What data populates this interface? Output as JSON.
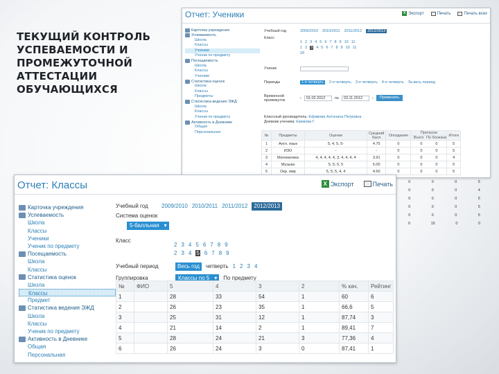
{
  "slide": {
    "title_lines": [
      "ТЕКУЩИЙ КОНТРОЛЬ",
      "УСПЕВАЕМОСТИ И",
      "ПРОМЕЖУТОЧНОЙ",
      "АТТЕСТАЦИИ",
      "ОБУЧАЮЩИХСЯ"
    ]
  },
  "shot1": {
    "title": "Отчет: Ученики",
    "toolbar": {
      "export": "Экспорт",
      "print": "Печать",
      "print_all": "Печать всех"
    },
    "sidebar": {
      "card": "Карточка учреждения",
      "progress": "Успеваемость",
      "progress_items": [
        "Школа",
        "Классы",
        "Ученики",
        "Ученик по предмету"
      ],
      "attendance": "Посещаемость",
      "attendance_items": [
        "Школа",
        "Классы",
        "Ученики"
      ],
      "grades_stats": "Статистика оценок",
      "grades_items": [
        "Школа",
        "Классы",
        "Предметы"
      ],
      "ejournal_stats": "Статистика ведения ЭЖД",
      "ejournal_items": [
        "Школа",
        "Классы",
        "Ученик по предмету"
      ],
      "activity": "Активность в Дневнике",
      "activity_items": [
        "Общая",
        "Персональная"
      ]
    },
    "form": {
      "year_label": "Учебный год",
      "years": [
        "2009/2010",
        "2010/2011",
        "2011/2012",
        "2012/2013"
      ],
      "class_label": "Класс",
      "class_row1": [
        "1",
        "2",
        "3",
        "4",
        "5",
        "6",
        "7",
        "8",
        "9",
        "10",
        "11"
      ],
      "class_row2": [
        "1",
        "2",
        "3",
        "4",
        "5",
        "6",
        "7",
        "8",
        "9",
        "10",
        "11"
      ],
      "class_extra": "2б",
      "student_label": "Ученик",
      "period_label": "Периоды",
      "periods": [
        "1-я четверть",
        "2-я четверть",
        "3-я четверть",
        "4-я четверть",
        "За весь период"
      ],
      "interval_label": "Временной промежуток",
      "date_from": "01.02.2012",
      "to_label": "по",
      "date_to": "03.11.2012",
      "apply": "Применить"
    },
    "info": {
      "teacher_label": "Классный руководитель:",
      "teacher_value": "Ефимова Антонина Петровна",
      "student_label": "Дневник ученика:",
      "student_value": "Екимова Г."
    },
    "table": {
      "top_headers": {
        "absences": "Пропуски"
      },
      "headers": [
        "№",
        "Предметы",
        "Оценки",
        "Средний балл",
        "Опоздания",
        "Всего",
        "По болезни",
        "Итоги"
      ],
      "rows": [
        [
          "1",
          "Англ. язык",
          "5, 4, 5, 5-",
          "4.75",
          "0",
          "0",
          "0",
          "5"
        ],
        [
          "2",
          "ИЗО",
          "-",
          "-",
          "0",
          "0",
          "0",
          "5"
        ],
        [
          "3",
          "Математика",
          "4, 4, 4, 4, 4, 3, 4, 4, 4, 4",
          "3.91",
          "0",
          "0",
          "0",
          "4"
        ],
        [
          "4",
          "Музыка",
          "5, 5, 5, 5",
          "5.00",
          "0",
          "0",
          "0",
          "5"
        ],
        [
          "5",
          "Окр. мир",
          "5, 5, 5, 4, 4",
          "4.60",
          "0",
          "0",
          "0",
          "5"
        ]
      ],
      "extra_rows": [
        [
          "0",
          "0",
          "0",
          "5"
        ],
        [
          "0",
          "0",
          "0",
          "4"
        ],
        [
          "0",
          "0",
          "0",
          "5"
        ],
        [
          "0",
          "0",
          "0",
          "5"
        ],
        [
          "0",
          "0",
          "0",
          "5"
        ],
        [
          "0",
          "15",
          "0",
          "0"
        ]
      ]
    }
  },
  "shot2": {
    "title": "Отчет: Классы",
    "toolbar": {
      "export": "Экспорт",
      "print": "Печать"
    },
    "sidebar": {
      "card": "Карточка учреждения",
      "progress": "Успеваемость",
      "progress_items": [
        "Школа",
        "Классы",
        "Ученики",
        "Ученик по предмету"
      ],
      "attendance": "Посещаемость",
      "attendance_items": [
        "Школа",
        "Классы"
      ],
      "grades_stats": "Статистика оценок",
      "grades_items": [
        "Школа",
        "Классы",
        "Предмет"
      ],
      "ejournal_stats": "Статистика ведения ЭЖД",
      "ejournal_items": [
        "Школа",
        "Классы",
        "Ученик по предмету"
      ],
      "activity": "Активность в Дневнике",
      "activity_items": [
        "Общая",
        "Персональная"
      ]
    },
    "form": {
      "year_label": "Учебный год",
      "years": [
        "2009/2010",
        "2010/2011",
        "2011/2012",
        "2012/2013"
      ],
      "scale_label": "Система оценок",
      "scale_value": "5-балльная",
      "class_label": "Класс",
      "class_row1": [
        "2",
        "3",
        "4",
        "5",
        "6",
        "7",
        "8",
        "9"
      ],
      "class_row2": [
        "2",
        "3",
        "4",
        "5",
        "6",
        "7",
        "8",
        "9"
      ],
      "period_label": "Учебный период",
      "period_selected": "Весь год",
      "periods": [
        "четверть",
        "1",
        "2",
        "3",
        "4"
      ],
      "group_label": "Группировка",
      "group_selected": "Классы по 5",
      "group_other": "По предмету"
    },
    "table": {
      "headers": [
        "№",
        "ФИО",
        "5",
        "4",
        "3",
        "2",
        "% кач.",
        "Рейтинг"
      ],
      "rows": [
        [
          "1",
          "",
          "28",
          "33",
          "54",
          "1",
          "60",
          "6"
        ],
        [
          "2",
          "",
          "26",
          "23",
          "35",
          "1",
          "66,6",
          "5"
        ],
        [
          "3",
          "",
          "25",
          "31",
          "12",
          "1",
          "87,74",
          "3"
        ],
        [
          "4",
          "",
          "21",
          "14",
          "2",
          "1",
          "89,41",
          "7"
        ],
        [
          "5",
          "",
          "28",
          "24",
          "21",
          "3",
          "77,36",
          "4"
        ],
        [
          "6",
          "",
          "26",
          "24",
          "3",
          "0",
          "87,41",
          "1"
        ]
      ]
    }
  }
}
